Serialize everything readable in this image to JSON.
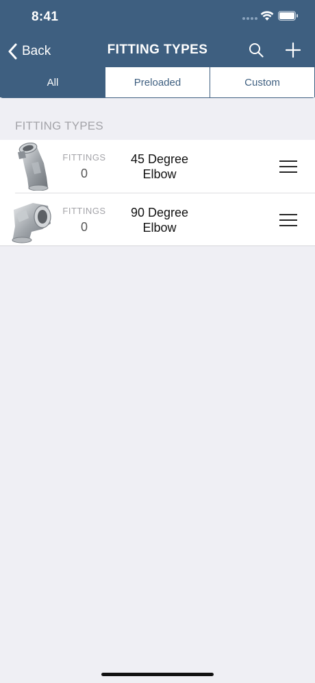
{
  "status_bar": {
    "time": "8:41"
  },
  "nav": {
    "back_label": "Back",
    "title": "FITTING TYPES",
    "icons": [
      "chevron-left-icon",
      "search-icon",
      "plus-icon"
    ]
  },
  "segments": {
    "items": [
      {
        "label": "All",
        "active": true
      },
      {
        "label": "Preloaded",
        "active": false
      },
      {
        "label": "Custom",
        "active": false
      }
    ]
  },
  "section": {
    "title": "FITTING TYPES"
  },
  "fittings": [
    {
      "name_line1": "45 Degree",
      "name_line2": "Elbow",
      "count_label": "FITTINGS",
      "count": "0",
      "image": "45-degree-elbow-image"
    },
    {
      "name_line1": "90 Degree",
      "name_line2": "Elbow",
      "count_label": "FITTINGS",
      "count": "0",
      "image": "90-degree-elbow-image"
    }
  ],
  "colors": {
    "header": "#3e5f80",
    "background": "#efeff4",
    "muted_text": "#a3a3a8"
  }
}
